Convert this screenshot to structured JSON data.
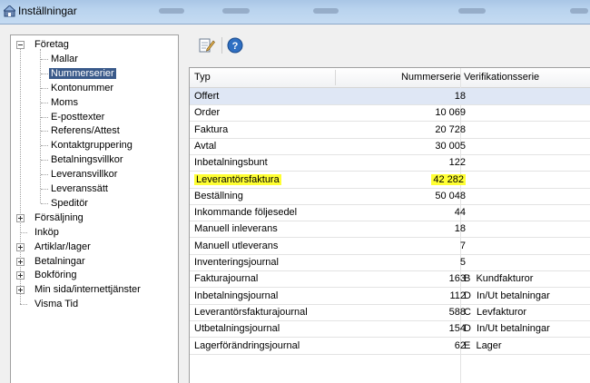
{
  "window": {
    "title": "Inställningar",
    "blurred_texts": []
  },
  "tree": {
    "items": [
      {
        "label": "Företag",
        "level": 0,
        "expander": "minus",
        "selected": false
      },
      {
        "label": "Mallar",
        "level": 1,
        "selected": false
      },
      {
        "label": "Nummerserier",
        "level": 1,
        "selected": true
      },
      {
        "label": "Kontonummer",
        "level": 1,
        "selected": false
      },
      {
        "label": "Moms",
        "level": 1,
        "selected": false
      },
      {
        "label": "E-posttexter",
        "level": 1,
        "selected": false
      },
      {
        "label": "Referens/Attest",
        "level": 1,
        "selected": false
      },
      {
        "label": "Kontaktgruppering",
        "level": 1,
        "selected": false
      },
      {
        "label": "Betalningsvillkor",
        "level": 1,
        "selected": false
      },
      {
        "label": "Leveransvillkor",
        "level": 1,
        "selected": false
      },
      {
        "label": "Leveranssätt",
        "level": 1,
        "selected": false
      },
      {
        "label": "Speditör",
        "level": 1,
        "selected": false
      },
      {
        "label": "Försäljning",
        "level": 0,
        "expander": "plus",
        "selected": false
      },
      {
        "label": "Inköp",
        "level": 0,
        "expander": "none",
        "selected": false
      },
      {
        "label": "Artiklar/lager",
        "level": 0,
        "expander": "plus",
        "selected": false
      },
      {
        "label": "Betalningar",
        "level": 0,
        "expander": "plus",
        "selected": false
      },
      {
        "label": "Bokföring",
        "level": 0,
        "expander": "plus",
        "selected": false
      },
      {
        "label": "Min sida/internettjänster",
        "level": 0,
        "expander": "plus",
        "selected": false
      },
      {
        "label": "Visma Tid",
        "level": 0,
        "expander": "none",
        "selected": false
      }
    ]
  },
  "toolbar": {
    "edit_icon": "edit-document-icon",
    "help_icon": "help-icon"
  },
  "grid": {
    "columns": [
      "Typ",
      "Nummerserie",
      "Verifikationsserie"
    ],
    "highlight_color": "#ffff33",
    "rows": [
      {
        "typ": "Offert",
        "nummer": "18",
        "ver": "",
        "highlight": false
      },
      {
        "typ": "Order",
        "nummer": "10 069",
        "ver": "",
        "highlight": false
      },
      {
        "typ": "Faktura",
        "nummer": "20 728",
        "ver": "",
        "highlight": false
      },
      {
        "typ": "Avtal",
        "nummer": "30 005",
        "ver": "",
        "highlight": false
      },
      {
        "typ": "Inbetalningsbunt",
        "nummer": "122",
        "ver": "",
        "highlight": false
      },
      {
        "typ": "Leverantörsfaktura",
        "nummer": "42 282",
        "ver": "",
        "highlight": true
      },
      {
        "typ": "Beställning",
        "nummer": "50 048",
        "ver": "",
        "highlight": false
      },
      {
        "typ": "Inkommande följesedel",
        "nummer": "44",
        "ver": "",
        "highlight": false
      },
      {
        "typ": "Manuell inleverans",
        "nummer": "18",
        "ver": "",
        "highlight": false
      },
      {
        "typ": "Manuell utleverans",
        "nummer": "7",
        "ver": "",
        "highlight": false
      },
      {
        "typ": "Inventeringsjournal",
        "nummer": "5",
        "ver": "",
        "highlight": false
      },
      {
        "typ": "Fakturajournal",
        "nummer": "163",
        "ver": "B  Kundfakturor",
        "highlight": false
      },
      {
        "typ": "Inbetalningsjournal",
        "nummer": "112",
        "ver": "D  In/Ut betalningar",
        "highlight": false
      },
      {
        "typ": "Leverantörsfakturajournal",
        "nummer": "588",
        "ver": "C  Levfakturor",
        "highlight": false
      },
      {
        "typ": "Utbetalningsjournal",
        "nummer": "154",
        "ver": "D  In/Ut betalningar",
        "highlight": false
      },
      {
        "typ": "Lagerförändringsjournal",
        "nummer": "62",
        "ver": "E  Lager",
        "highlight": false
      }
    ]
  }
}
